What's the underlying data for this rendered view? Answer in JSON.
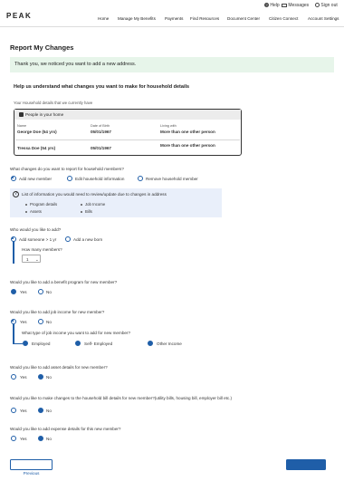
{
  "brand": {
    "logo": "PEAK"
  },
  "utility": {
    "help": "Help",
    "messages": "Messages",
    "signout": "Sign out"
  },
  "nav": [
    "Home",
    "Manage My Benefits",
    "Payments",
    "Find Resources",
    "Document Center",
    "Citizen Connect",
    "Account Settings"
  ],
  "page": {
    "title": "Report My Changes",
    "banner": "Thank you, we noticed you want to add a new address.",
    "subtitle": "Help us understand what changes you want to make for household details",
    "household_caption": "Your Household details that we currently have"
  },
  "household": {
    "header": "People in your home",
    "col_name": "Name",
    "col_dob": "Date of Birth",
    "col_living": "Living with",
    "rows": [
      {
        "name": "George Doe (54 yrs)",
        "dob": "05/01/1967",
        "living": "More than one other person"
      },
      {
        "name": "Tressa Doe (54 yrs)",
        "dob": "05/01/1967",
        "living": "More than one other person"
      }
    ]
  },
  "changes": {
    "question": "What changes do you want to report for household members?",
    "options": [
      "Add new member",
      "Edit household information",
      "Remove household member"
    ],
    "selected": "Add new member"
  },
  "info": {
    "title": "List of information you would need to review/update due to changes in address",
    "items": [
      "Program details",
      "Job Income",
      "Assets",
      "Bills"
    ]
  },
  "who": {
    "question": "Who would you like to add?",
    "options": [
      "Add someone > 1 yr",
      "Add a new born"
    ],
    "selected": "Add someone > 1 yr",
    "count_label": "How many members?",
    "count_value": "1"
  },
  "benefit": {
    "question": "Would you like to add a benefit program for new member?",
    "yes": "Yes",
    "no": "No",
    "selected": "Yes"
  },
  "job": {
    "question": "Would you like to add job income for new member?",
    "yes": "Yes",
    "no": "No",
    "selected": "Yes",
    "type_question": "What type of job income you want to add for new member?",
    "types": [
      "Employed",
      "Self- Employed",
      "Other Income"
    ],
    "type_selected": "Employed"
  },
  "asset": {
    "question": "Would you like to add asset details for new member?",
    "yes": "Yes",
    "no": "No",
    "selected": "No"
  },
  "bill": {
    "question": "Would you like to make changes to the household bill details for new member?(utility bills, housing bill, employer bill etc.)",
    "yes": "Yes",
    "no": "No",
    "selected": "No"
  },
  "expense": {
    "question": "Would you like to add expense details for this new member?",
    "yes": "Yes",
    "no": "No",
    "selected": "No"
  },
  "footer": {
    "previous": "Previous",
    "next": "Next"
  },
  "colors": {
    "accent": "#1f5ea8",
    "banner_bg": "#e7f5ea",
    "info_bg": "#e9effa"
  },
  "icons": [
    "help-icon",
    "mail-icon",
    "signout-icon",
    "home-people-icon",
    "question-icon",
    "chevron-down-icon"
  ]
}
